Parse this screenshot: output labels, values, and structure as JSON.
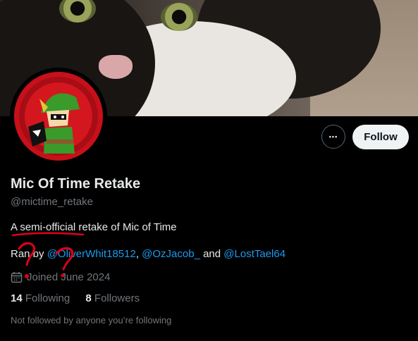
{
  "profile": {
    "display_name": "Mic Of Time Retake",
    "handle": "@mictime_retake",
    "bio": "A semi-official retake of Mic of Time",
    "ran_by": {
      "prefix": "Ran by ",
      "links": [
        "@OliverWhit18512",
        "@OzJacob_",
        "@LostTael64"
      ],
      "sep1": ", ",
      "sep2": " and "
    },
    "joined": "Joined June 2024",
    "following_count": "14",
    "following_label": " Following",
    "followers_count": "8",
    "followers_label": " Followers",
    "mutual_text": "Not followed by anyone you’re following"
  },
  "actions": {
    "more_label": "•••",
    "follow_label": "Follow"
  },
  "annotation": {
    "color": "#e0001a",
    "symbols": "??"
  },
  "icons": {
    "calendar": "calendar-icon"
  }
}
